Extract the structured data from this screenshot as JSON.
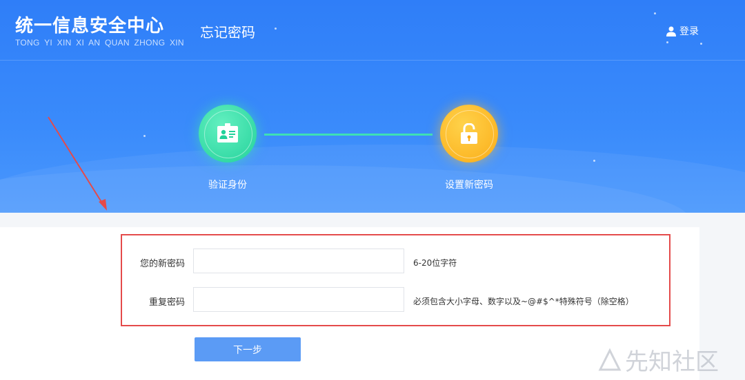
{
  "header": {
    "logo_cn": "统一信息安全中心",
    "logo_en": "TONG YI XIN XI AN QUAN ZHONG XIN",
    "page_name": "忘记密码",
    "login_label": "登录"
  },
  "steps": [
    {
      "label": "验证身份",
      "icon": "id-card-icon"
    },
    {
      "label": "设置新密码",
      "icon": "unlock-icon"
    }
  ],
  "form": {
    "new_password": {
      "label": "您的新密码",
      "value": "",
      "hint": "6-20位字符"
    },
    "repeat_password": {
      "label": "重复密码",
      "value": "",
      "hint": "必须包含大小字母、数字以及~@#$^*特殊符号（除空格）"
    }
  },
  "next_button": "下一步",
  "watermark": "先知社区",
  "colors": {
    "header_bg": "#2f7ef8",
    "step1": "#22d19a",
    "step2": "#fbac17",
    "button": "#5b9bf5",
    "highlight": "#e44a4a"
  }
}
